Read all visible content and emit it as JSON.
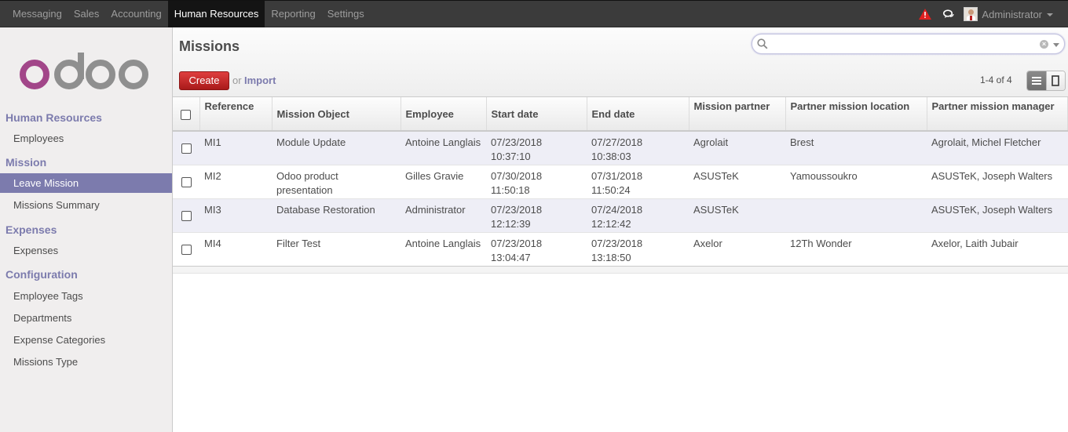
{
  "topbar": {
    "menu": [
      "Messaging",
      "Sales",
      "Accounting",
      "Human Resources",
      "Reporting",
      "Settings"
    ],
    "active_menu": "Human Resources",
    "user": "Administrator"
  },
  "sidebar": {
    "sections": [
      {
        "title": "Human Resources",
        "items": [
          "Employees"
        ]
      },
      {
        "title": "Mission",
        "items": [
          "Leave Mission",
          "Missions Summary"
        ]
      },
      {
        "title": "Expenses",
        "items": [
          "Expenses"
        ]
      },
      {
        "title": "Configuration",
        "items": [
          "Employee Tags",
          "Departments",
          "Expense Categories",
          "Missions Type"
        ]
      }
    ],
    "active_item": "Leave Mission"
  },
  "header": {
    "title": "Missions",
    "search_placeholder": "",
    "create_label": "Create",
    "or_label": "or",
    "import_label": "Import",
    "pager": "1-4 of 4"
  },
  "table": {
    "columns": [
      "Reference",
      "Mission Object",
      "Employee",
      "Start date",
      "End date",
      "Mission partner",
      "Partner mission location",
      "Partner mission manager"
    ],
    "rows": [
      [
        "MI1",
        "Module Update",
        "Antoine Langlais",
        "07/23/2018 10:37:10",
        "07/27/2018 10:38:03",
        "Agrolait",
        "Brest",
        "Agrolait, Michel Fletcher"
      ],
      [
        "MI2",
        "Odoo product presentation",
        "Gilles Gravie",
        "07/30/2018 11:50:18",
        "07/31/2018 11:50:24",
        "ASUSTeK",
        "Yamoussoukro",
        "ASUSTeK, Joseph Walters"
      ],
      [
        "MI3",
        "Database Restoration",
        "Administrator",
        "07/23/2018 12:12:39",
        "07/24/2018 12:12:42",
        "ASUSTeK",
        "",
        "ASUSTeK, Joseph Walters"
      ],
      [
        "MI4",
        "Filter Test",
        "Antoine Langlais",
        "07/23/2018 13:04:47",
        "07/23/2018 13:18:50",
        "Axelor",
        "12Th Wonder",
        "Axelor, Laith Jubair"
      ]
    ]
  },
  "colors": {
    "accent": "#7c7bad",
    "create": "#c02828",
    "topbar": "#3b3b3b"
  }
}
